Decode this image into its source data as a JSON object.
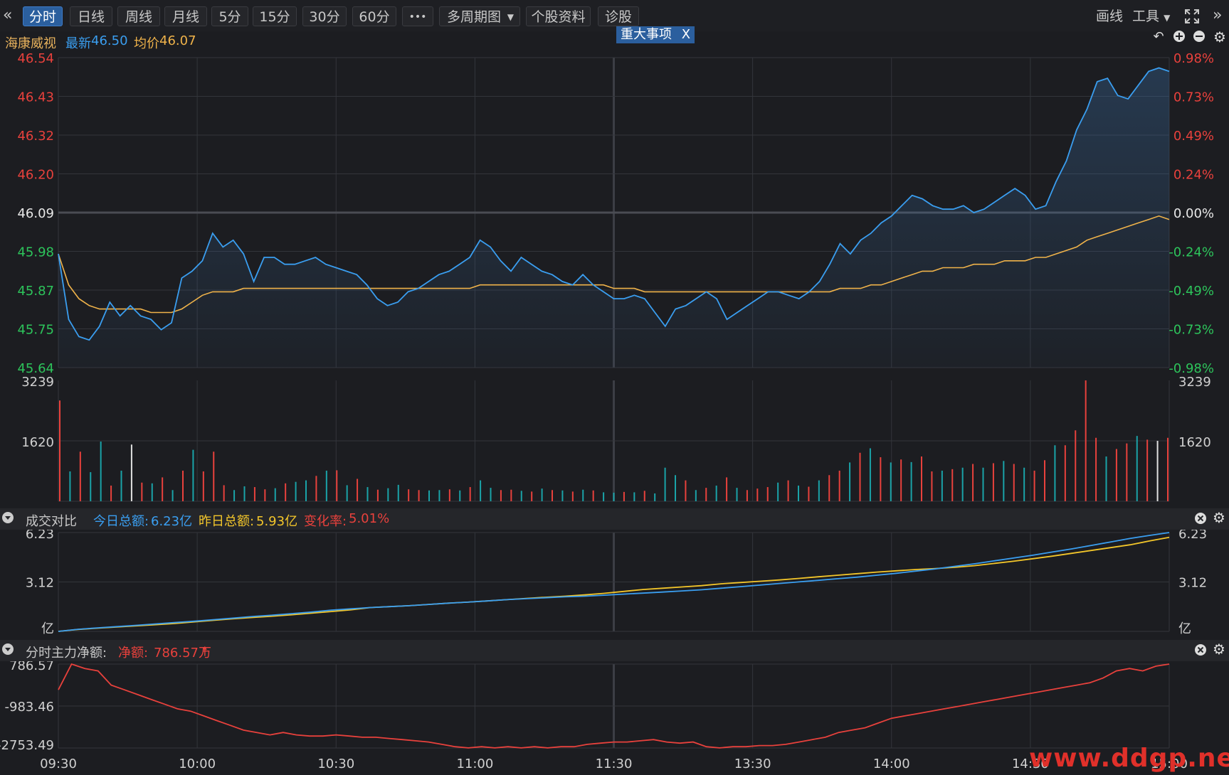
{
  "toolbar": {
    "collapse_icon": "double-chevron-left",
    "tabs": [
      "分时",
      "日线",
      "周线",
      "月线",
      "5分",
      "15分",
      "30分",
      "60分"
    ],
    "active_tab": "分时",
    "more_label": "•••",
    "multi_period_label": "多周期图",
    "stock_info_label": "个股资料",
    "diagnose_label": "诊股",
    "draw_label": "画线",
    "tools_label": "工具",
    "fullscreen_icon": "expand-icon",
    "expand_right_icon": "double-chevron-right"
  },
  "info": {
    "stock_name": "海康威视",
    "latest_label": "最新",
    "latest_value": "46.50",
    "avg_label": "均价",
    "avg_value": "46.07",
    "event_badge": "重大事项",
    "event_close": "X"
  },
  "price_axis": {
    "left": [
      "46.54",
      "46.43",
      "46.32",
      "46.20",
      "46.09",
      "45.98",
      "45.87",
      "45.75",
      "45.64"
    ],
    "right": [
      "0.98%",
      "0.73%",
      "0.49%",
      "0.24%",
      "0.00%",
      "-0.24%",
      "-0.49%",
      "-0.73%",
      "-0.98%"
    ]
  },
  "volume_axis": {
    "left": [
      "3239",
      "1620"
    ],
    "right": [
      "3239",
      "1620"
    ]
  },
  "turnover_panel": {
    "title": "成交对比",
    "today_label": "今日总额:",
    "today_value": "6.23亿",
    "yesterday_label": "昨日总额:",
    "yesterday_value": "5.93亿",
    "change_label": "变化率:",
    "change_value": "5.01%",
    "axis_left": [
      "6.23",
      "3.12",
      "亿"
    ],
    "axis_right": [
      "6.23",
      "3.12",
      "亿"
    ]
  },
  "netflow_panel": {
    "title": "分时主力净额:",
    "net_label": "净额:",
    "net_value": "786.57万",
    "axis_left": [
      "786.57",
      "-983.46",
      "-2753.49"
    ]
  },
  "time_axis": [
    "09:30",
    "10:00",
    "10:30",
    "11:00",
    "11:30",
    "13:30",
    "14:00",
    "14:30",
    "15:00"
  ],
  "watermark": "www.ddgp.net",
  "colors": {
    "price_line": "#3a9ef0",
    "avg_line": "#f0b34a",
    "up": "#e8413c",
    "down": "#1aa3a8",
    "flat": "#e0e0e0",
    "grid": "#33353b",
    "yesterday_total": "#f3c62a"
  },
  "chart_data": [
    {
      "type": "line",
      "name": "price",
      "xlabel": "",
      "ylabel": "",
      "ylim": [
        45.64,
        46.54
      ],
      "prev_close": 46.09,
      "series": [
        {
          "name": "最新",
          "values": [
            45.97,
            45.78,
            45.73,
            45.72,
            45.76,
            45.83,
            45.79,
            45.82,
            45.79,
            45.78,
            45.75,
            45.77,
            45.9,
            45.92,
            45.95,
            46.03,
            45.99,
            46.01,
            45.97,
            45.89,
            45.96,
            45.96,
            45.94,
            45.94,
            45.95,
            45.96,
            45.94,
            45.93,
            45.92,
            45.91,
            45.88,
            45.84,
            45.82,
            45.83,
            45.86,
            45.87,
            45.89,
            45.91,
            45.92,
            45.94,
            45.96,
            46.01,
            45.99,
            45.95,
            45.92,
            45.96,
            45.94,
            45.92,
            45.91,
            45.89,
            45.88,
            45.91,
            45.88,
            45.86,
            45.84,
            45.84,
            45.85,
            45.84,
            45.8,
            45.76,
            45.81,
            45.82,
            45.84,
            45.86,
            45.84,
            45.78,
            45.8,
            45.82,
            45.84,
            45.86,
            45.86,
            45.85,
            45.84,
            45.86,
            45.89,
            45.94,
            46.0,
            45.97,
            46.01,
            46.03,
            46.06,
            46.08,
            46.11,
            46.14,
            46.13,
            46.11,
            46.1,
            46.1,
            46.11,
            46.09,
            46.1,
            46.12,
            46.14,
            46.16,
            46.14,
            46.1,
            46.11,
            46.18,
            46.24,
            46.33,
            46.39,
            46.47,
            46.48,
            46.43,
            46.42,
            46.46,
            46.5,
            46.51,
            46.5
          ]
        },
        {
          "name": "均价",
          "values": [
            45.97,
            45.88,
            45.84,
            45.82,
            45.81,
            45.81,
            45.81,
            45.81,
            45.81,
            45.8,
            45.8,
            45.8,
            45.81,
            45.83,
            45.85,
            45.86,
            45.86,
            45.86,
            45.87,
            45.87,
            45.87,
            45.87,
            45.87,
            45.87,
            45.87,
            45.87,
            45.87,
            45.87,
            45.87,
            45.87,
            45.87,
            45.87,
            45.87,
            45.87,
            45.87,
            45.87,
            45.87,
            45.87,
            45.87,
            45.87,
            45.87,
            45.88,
            45.88,
            45.88,
            45.88,
            45.88,
            45.88,
            45.88,
            45.88,
            45.88,
            45.88,
            45.88,
            45.88,
            45.88,
            45.87,
            45.87,
            45.87,
            45.86,
            45.86,
            45.86,
            45.86,
            45.86,
            45.86,
            45.86,
            45.86,
            45.86,
            45.86,
            45.86,
            45.86,
            45.86,
            45.86,
            45.86,
            45.86,
            45.86,
            45.86,
            45.86,
            45.87,
            45.87,
            45.87,
            45.88,
            45.88,
            45.89,
            45.9,
            45.91,
            45.92,
            45.92,
            45.93,
            45.93,
            45.93,
            45.94,
            45.94,
            45.94,
            45.95,
            45.95,
            45.95,
            45.96,
            45.96,
            45.97,
            45.98,
            45.99,
            46.01,
            46.02,
            46.03,
            46.04,
            46.05,
            46.06,
            46.07,
            46.08,
            46.07
          ]
        }
      ]
    },
    {
      "type": "bar",
      "name": "volume",
      "ylim": [
        0,
        3239
      ],
      "values": [
        2700,
        800,
        1330,
        780,
        1600,
        420,
        820,
        1520,
        500,
        480,
        640,
        300,
        820,
        1380,
        800,
        1330,
        430,
        300,
        400,
        380,
        320,
        350,
        480,
        520,
        560,
        680,
        820,
        830,
        430,
        600,
        380,
        310,
        350,
        440,
        320,
        300,
        290,
        300,
        320,
        290,
        380,
        560,
        360,
        300,
        310,
        280,
        260,
        340,
        300,
        290,
        260,
        310,
        290,
        240,
        230,
        250,
        240,
        280,
        210,
        900,
        700,
        560,
        300,
        360,
        420,
        640,
        360,
        300,
        340,
        380,
        500,
        560,
        420,
        390,
        560,
        700,
        820,
        1040,
        1300,
        1420,
        1180,
        1040,
        1120,
        1050,
        1200,
        800,
        820,
        860,
        900,
        1000,
        900,
        1020,
        1080,
        1000,
        900,
        820,
        1100,
        1500,
        1500,
        1900,
        3239,
        1700,
        1200,
        1400,
        1550,
        1750,
        1650,
        1620,
        1700
      ],
      "colors": [
        "up",
        "down",
        "up",
        "down",
        "down",
        "up",
        "down",
        "flat",
        "up",
        "down",
        "up",
        "down",
        "up",
        "down",
        "up",
        "up",
        "up",
        "down",
        "down",
        "up",
        "up",
        "down",
        "up",
        "down",
        "down",
        "up",
        "down",
        "up",
        "down",
        "up",
        "down",
        "up",
        "down",
        "down",
        "up",
        "up",
        "down",
        "down",
        "up",
        "down",
        "up",
        "down",
        "down",
        "up",
        "up",
        "down",
        "up",
        "down",
        "up",
        "down",
        "up",
        "down",
        "up",
        "down",
        "down",
        "up",
        "down",
        "up",
        "down",
        "down",
        "down",
        "up",
        "down",
        "up",
        "down",
        "up",
        "down",
        "up",
        "up",
        "up",
        "down",
        "up",
        "down",
        "up",
        "down",
        "up",
        "up",
        "down",
        "up",
        "down",
        "up",
        "down",
        "up",
        "down",
        "up",
        "up",
        "down",
        "up",
        "down",
        "up",
        "down",
        "up",
        "down",
        "up",
        "down",
        "up",
        "up",
        "down",
        "up",
        "up",
        "up",
        "up",
        "down",
        "up",
        "up",
        "down",
        "up",
        "flat",
        "up",
        "up",
        "down"
      ]
    },
    {
      "type": "line",
      "name": "turnover",
      "ylim": [
        0,
        6.23
      ],
      "series": [
        {
          "name": "今日总额",
          "values": [
            0.0,
            0.13,
            0.22,
            0.3,
            0.38,
            0.47,
            0.56,
            0.64,
            0.74,
            0.84,
            0.94,
            1.02,
            1.12,
            1.22,
            1.34,
            1.42,
            1.5,
            1.56,
            1.62,
            1.7,
            1.78,
            1.84,
            1.92,
            2.0,
            2.06,
            2.12,
            2.18,
            2.22,
            2.28,
            2.35,
            2.41,
            2.48,
            2.55,
            2.62,
            2.72,
            2.82,
            2.92,
            3.02,
            3.12,
            3.22,
            3.32,
            3.42,
            3.54,
            3.66,
            3.8,
            3.94,
            4.1,
            4.26,
            4.44,
            4.62,
            4.8,
            5.0,
            5.2,
            5.42,
            5.64,
            5.86,
            6.05,
            6.23
          ]
        },
        {
          "name": "昨日总额",
          "values": [
            0.0,
            0.12,
            0.2,
            0.28,
            0.35,
            0.42,
            0.5,
            0.6,
            0.7,
            0.8,
            0.88,
            0.96,
            1.05,
            1.15,
            1.25,
            1.36,
            1.5,
            1.56,
            1.62,
            1.7,
            1.78,
            1.84,
            1.92,
            2.0,
            2.08,
            2.15,
            2.22,
            2.3,
            2.4,
            2.52,
            2.64,
            2.72,
            2.8,
            2.88,
            3.0,
            3.08,
            3.16,
            3.24,
            3.34,
            3.44,
            3.54,
            3.64,
            3.74,
            3.82,
            3.9,
            3.96,
            4.04,
            4.14,
            4.28,
            4.42,
            4.58,
            4.74,
            4.92,
            5.1,
            5.28,
            5.46,
            5.7,
            5.93
          ]
        }
      ]
    },
    {
      "type": "line",
      "name": "main_net_flow",
      "ylim": [
        -2753.49,
        786.57
      ],
      "series": [
        {
          "name": "分时主力净额",
          "values": [
            -300,
            786,
            600,
            500,
            -100,
            -300,
            -500,
            -700,
            -900,
            -1100,
            -1200,
            -1400,
            -1600,
            -1800,
            -2000,
            -2100,
            -2200,
            -2100,
            -2200,
            -2250,
            -2250,
            -2200,
            -2250,
            -2300,
            -2300,
            -2350,
            -2400,
            -2450,
            -2500,
            -2600,
            -2700,
            -2750,
            -2700,
            -2750,
            -2700,
            -2750,
            -2700,
            -2750,
            -2700,
            -2700,
            -2600,
            -2550,
            -2500,
            -2500,
            -2450,
            -2400,
            -2500,
            -2550,
            -2500,
            -2700,
            -2750,
            -2700,
            -2700,
            -2650,
            -2650,
            -2600,
            -2500,
            -2400,
            -2300,
            -2100,
            -2000,
            -1900,
            -1700,
            -1500,
            -1400,
            -1300,
            -1200,
            -1100,
            -1000,
            -900,
            -800,
            -700,
            -600,
            -500,
            -400,
            -300,
            -200,
            -100,
            0,
            200,
            500,
            600,
            500,
            700,
            786
          ]
        }
      ]
    }
  ]
}
